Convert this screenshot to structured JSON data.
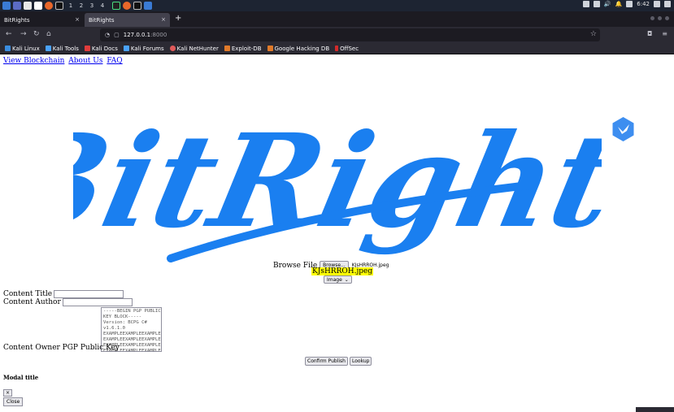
{
  "taskbar": {
    "workspaces": [
      "1",
      "2",
      "3",
      "4"
    ],
    "clock": "6:42"
  },
  "browser": {
    "tabs": [
      {
        "label": "BitRights",
        "close": "×"
      },
      {
        "label": "BitRights",
        "close": "×"
      }
    ],
    "new_tab": "+",
    "url_host": "127.0.0.1",
    "url_port": ":8000",
    "bookmarks": [
      {
        "label": "Kali Linux",
        "color": "#3a8de0"
      },
      {
        "label": "Kali Tools",
        "color": "#4aa3ff"
      },
      {
        "label": "Kali Docs",
        "color": "#e03b3b"
      },
      {
        "label": "Kali Forums",
        "color": "#4aa3ff"
      },
      {
        "label": "Kali NetHunter",
        "color": "#e05a5a"
      },
      {
        "label": "Exploit-DB",
        "color": "#e07a2a"
      },
      {
        "label": "Google Hacking DB",
        "color": "#e07a2a"
      },
      {
        "label": "OffSec",
        "color": "#d42a2a"
      }
    ]
  },
  "page": {
    "links": [
      "View Blockchain",
      "About Us",
      "FAQ"
    ],
    "logo_text": "BitRights",
    "logo_color": "#1a7ff0",
    "browse_label": "Browse File",
    "browse_button": "Browse...",
    "file_name": "KJsHRROH.jpeg",
    "highlight_text": "KJsHRROH.jpeg",
    "type_select": "Image",
    "content_title_label": "Content Title",
    "content_author_label": "Content Author",
    "pgp_label": "Content Owner PGP Public Key",
    "pgp_placeholder": "-----BEGIN PGP PUBLIC\nKEY BLOCK-----\nVersion: BCPG C#\nv1.6.1.0\nEXAMPLEEXAMPLEEXAMPLE\nEXAMPLEEXAMPLEEXAMPLE\nEXAMPLEEXAMPLEEXAMPLE\nEXAMPLEEXAMPLEEXAMPLE&",
    "confirm_button": "Confirm Publish",
    "lookup_button": "Lookup",
    "modal_title": "Modal title",
    "x_button": "×",
    "close_button": "Close"
  }
}
